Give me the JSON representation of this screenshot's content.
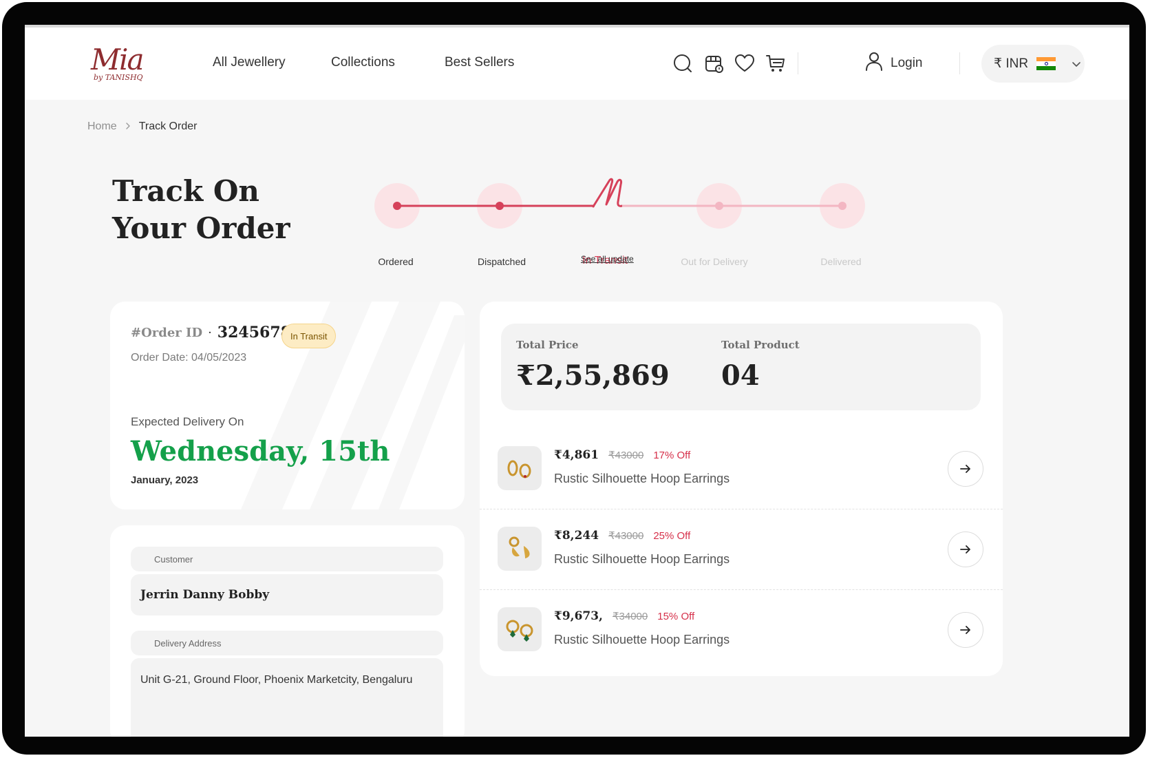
{
  "brand": {
    "logo_text": "Mia",
    "logo_sub": "by TANISHQ"
  },
  "nav": {
    "items": [
      "All Jewellery",
      "Collections",
      "Best Sellers"
    ]
  },
  "header": {
    "icons": [
      "search-icon",
      "store-icon",
      "heart-icon",
      "cart-icon",
      "user-icon"
    ],
    "login_label": "Login",
    "currency_label": "₹ INR",
    "colors": {
      "flag_saffron": "#ff9933",
      "flag_white": "#ffffff",
      "flag_green": "#138808"
    }
  },
  "breadcrumb": {
    "home": "Home",
    "current": "Track Order"
  },
  "page": {
    "title_line1": "Track On",
    "title_line2": "Your Order"
  },
  "tracker": {
    "steps": [
      "Ordered",
      "Dispatched",
      "In Transit",
      "Out for Delivery",
      "Delivered"
    ],
    "current_step": "In Transit",
    "see_all_label": "See all update",
    "colors": {
      "active": "#d6415a",
      "inactive": "#f3b6c2",
      "halo": "#fbe3e6"
    }
  },
  "order": {
    "id_label": "#Order ID",
    "id": "3245678",
    "status_badge": "In Transit",
    "date": "Order Date: 04/05/2023",
    "expected_label": "Expected Delivery On",
    "expected_day": "Wednesday, 15th",
    "expected_month_year": "January, 2023"
  },
  "customer": {
    "label": "Customer",
    "name": "Jerrin Danny Bobby",
    "address_label": "Delivery Address",
    "address_line1": "Unit G-21, Ground Floor, Phoenix Marketcity, Bengaluru"
  },
  "summary": {
    "total_price_label": "Total Price",
    "total_price": "₹2,55,869",
    "total_product_label": "Total Product",
    "total_product": "04"
  },
  "products": [
    {
      "price": "₹4,861",
      "mrp": "₹43000",
      "discount": "17% Off",
      "name": "Rustic Silhouette Hoop Earrings"
    },
    {
      "price": "₹8,244",
      "mrp": "₹43000",
      "discount": "25% Off",
      "name": "Rustic Silhouette Hoop Earrings"
    },
    {
      "price": "₹9,673,",
      "mrp": "₹34000",
      "discount": "15% Off",
      "name": "Rustic Silhouette Hoop Earrings"
    }
  ]
}
